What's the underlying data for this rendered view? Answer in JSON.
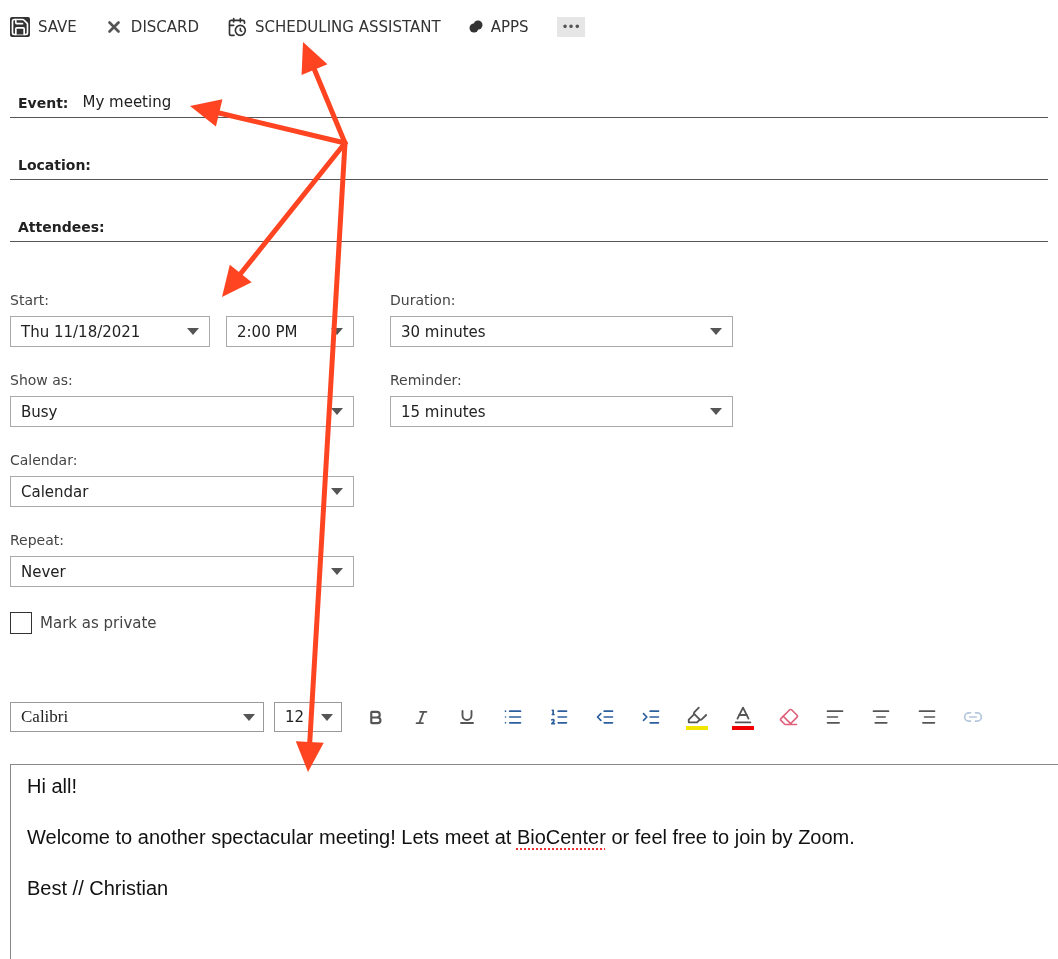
{
  "toolbar": [
    {
      "kind": "save",
      "label": "SAVE"
    },
    {
      "kind": "discard",
      "label": "DISCARD"
    },
    {
      "kind": "schedule",
      "label": "SCHEDULING ASSISTANT"
    },
    {
      "kind": "apps",
      "label": "APPS"
    },
    {
      "kind": "more",
      "label": "•••"
    }
  ],
  "fields": [
    {
      "label": "Event:",
      "value": "My meeting"
    },
    {
      "label": "Location:"
    },
    {
      "label": "Attendees:"
    }
  ],
  "start": {
    "label": "Start:",
    "date": "Thu 11/18/2021",
    "time": "2:00 PM"
  },
  "duration": {
    "label": "Duration:",
    "value": "30 minutes"
  },
  "show_as": {
    "label": "Show as:",
    "value": "Busy"
  },
  "reminder": {
    "label": "Reminder:",
    "value": "15 minutes"
  },
  "calendar": {
    "label": "Calendar:",
    "value": "Calendar"
  },
  "repeat": {
    "label": "Repeat:",
    "value": "Never"
  },
  "private": {
    "label": "Mark as private",
    "checked": false
  },
  "format_bar": {
    "font": "Calibri",
    "size": "12",
    "buttons": [
      {
        "kind": "bold",
        "disabled": false
      },
      {
        "kind": "italic",
        "disabled": false
      },
      {
        "kind": "underline",
        "disabled": false
      },
      {
        "kind": "bullets",
        "disabled": false
      },
      {
        "kind": "numbering",
        "disabled": false
      },
      {
        "kind": "outdent",
        "disabled": false
      },
      {
        "kind": "indent",
        "disabled": false
      },
      {
        "kind": "highlight",
        "disabled": false
      },
      {
        "kind": "font_color",
        "disabled": false
      },
      {
        "kind": "clear_format",
        "disabled": false
      },
      {
        "kind": "align_left",
        "disabled": false
      },
      {
        "kind": "align_center",
        "disabled": false
      },
      {
        "kind": "align_right",
        "disabled": false
      },
      {
        "kind": "link",
        "disabled": true
      }
    ]
  },
  "body": [
    [
      {
        "text": "Hi all!"
      }
    ],
    [
      {
        "text": "Welcome to another spectacular meeting! Lets meet at "
      },
      {
        "text": "BioCenter",
        "misspelled": true
      },
      {
        "text": " or feel free to join by Zoom."
      }
    ],
    [
      {
        "text": "Best // Christian"
      }
    ]
  ]
}
